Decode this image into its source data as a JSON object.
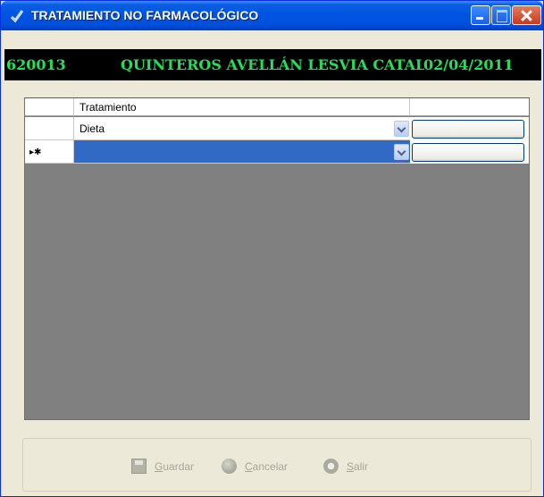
{
  "window": {
    "title": "TRATAMIENTO NO FARMACOLÓGICO",
    "controls": [
      "minimize-icon",
      "maximize-icon",
      "close-icon"
    ]
  },
  "patient": {
    "id": "620013",
    "name": "QUINTEROS AVELLÁN LESVIA CATALINA",
    "date": "02/04/2011"
  },
  "grid": {
    "columns": [
      "Tratamiento",
      ""
    ],
    "rows": [
      {
        "row_marker": "",
        "tratamiento": "Dieta"
      },
      {
        "row_marker": "▸✱",
        "tratamiento": ""
      }
    ]
  },
  "toolbar": {
    "save_first": "G",
    "save_rest": "uardar",
    "cancel_first": "C",
    "cancel_rest": "ancelar",
    "exit_first": "S",
    "exit_rest": "alir"
  },
  "colors": {
    "titlebar": "#0054e3",
    "patient_bar_bg": "#000000",
    "patient_text": "#22e05a",
    "grid_bg": "#808080",
    "selected_row": "#316ac5",
    "disabled_text": "#a6a69a"
  }
}
